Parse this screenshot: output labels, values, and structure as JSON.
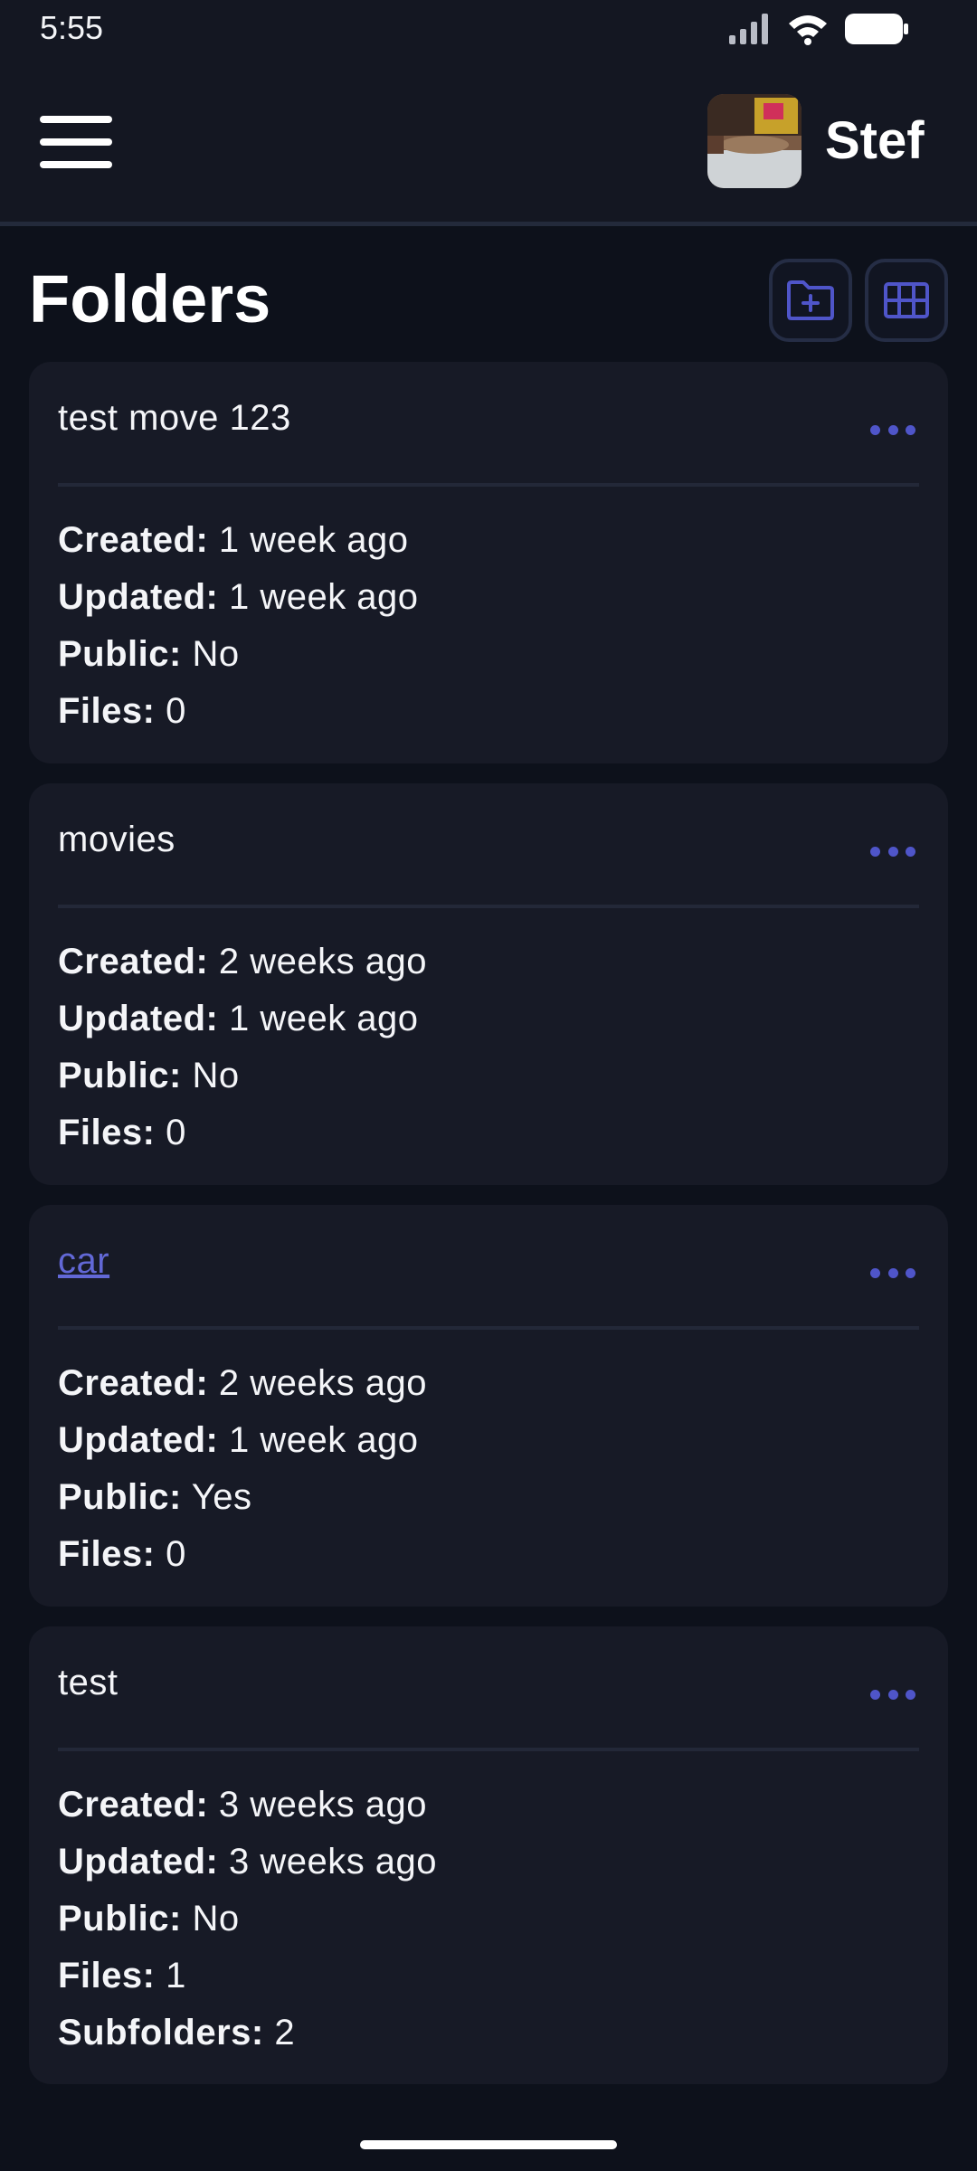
{
  "status_bar": {
    "time": "5:55"
  },
  "header": {
    "user_name": "Stef"
  },
  "page": {
    "title": "Folders"
  },
  "icons": {
    "menu": "hamburger-menu-icon",
    "new_folder": "folder-plus-icon",
    "grid_view": "grid-icon",
    "more": "more-horizontal-icon"
  },
  "colors": {
    "background": "#0d111b",
    "header": "#141722",
    "card": "#171a26",
    "accent": "#4f55c9",
    "link": "#6268d6"
  },
  "labels": {
    "created": "Created:",
    "updated": "Updated:",
    "public": "Public:",
    "files": "Files:",
    "subfolders": "Subfolders:"
  },
  "folders": [
    {
      "name": "test move 123",
      "created": "1 week ago",
      "updated": "1 week ago",
      "public": "No",
      "files": "0"
    },
    {
      "name": "movies",
      "created": "2 weeks ago",
      "updated": "1 week ago",
      "public": "No",
      "files": "0"
    },
    {
      "name": "car",
      "created": "2 weeks ago",
      "updated": "1 week ago",
      "public": "Yes",
      "files": "0"
    },
    {
      "name": "test",
      "created": "3 weeks ago",
      "updated": "3 weeks ago",
      "public": "No",
      "files": "1",
      "subfolders": "2"
    }
  ]
}
